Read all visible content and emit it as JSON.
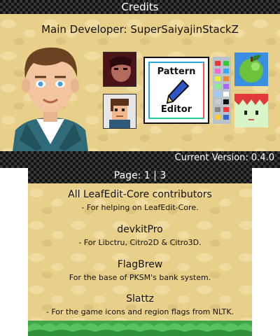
{
  "top": {
    "title": "Credits",
    "developer_line": "Main Developer: SuperSaiyajinStackZ",
    "pattern_editor": {
      "line1": "Pattern",
      "line2": "Editor"
    },
    "version": "Current Version: 0.4.0"
  },
  "bottom": {
    "page_label": "Page: 1 | 3",
    "credits": [
      {
        "title": "All LeafEdit-Core contributors",
        "desc": "- For helping on LeafEdit-Core."
      },
      {
        "title": "devkitPro",
        "desc": "- For Libctru, Citro2D & Citro3D."
      },
      {
        "title": "FlagBrew",
        "desc": "For the base of PKSM's bank system."
      },
      {
        "title": "Slattz",
        "desc": "- For the game icons and region flags from NLTK."
      }
    ]
  },
  "colors": {
    "accent_blue": "#2aa9d8",
    "sand": "#e8d08a",
    "grass": "#3fa64a"
  },
  "icons": [
    "avatar-icon",
    "contributor-red-icon",
    "contributor-boy-icon",
    "pattern-pen-icon",
    "apple-leaf-icon",
    "face-pattern-icon"
  ]
}
